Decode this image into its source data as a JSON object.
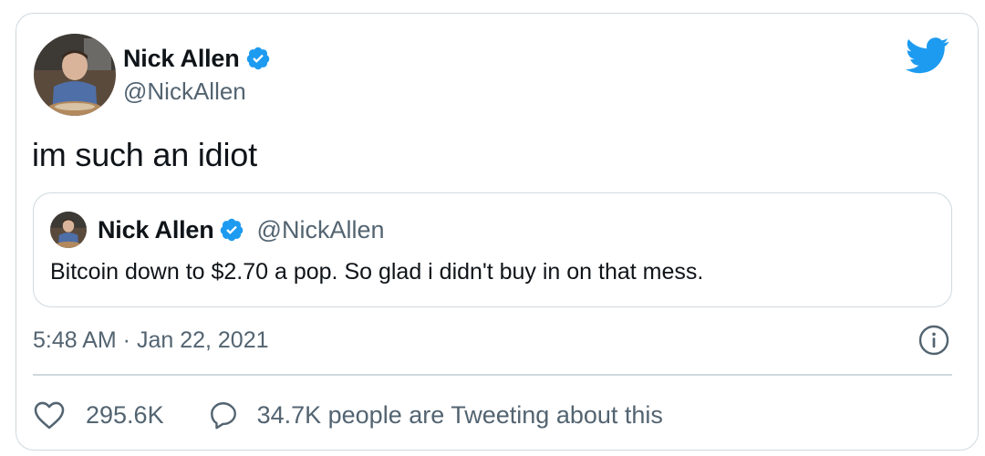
{
  "author": {
    "name": "Nick Allen",
    "handle": "@NickAllen",
    "verified": true
  },
  "tweet": {
    "text": "im such an idiot",
    "timestamp": "5:48 AM · Jan 22, 2021"
  },
  "quoted_tweet": {
    "name": "Nick Allen",
    "handle": "@NickAllen",
    "verified": true,
    "text": "Bitcoin down to $2.70 a pop. So glad i didn't buy in on that mess."
  },
  "stats": {
    "likes": "295.6K",
    "tweeting_text": "34.7K people are Tweeting about this"
  },
  "colors": {
    "brand_blue": "#1d9bf0",
    "secondary_text": "#536471",
    "border": "#cfd9de"
  },
  "icons": [
    "twitter-bird-icon",
    "verified-badge-icon",
    "info-icon",
    "heart-icon",
    "reply-icon"
  ]
}
